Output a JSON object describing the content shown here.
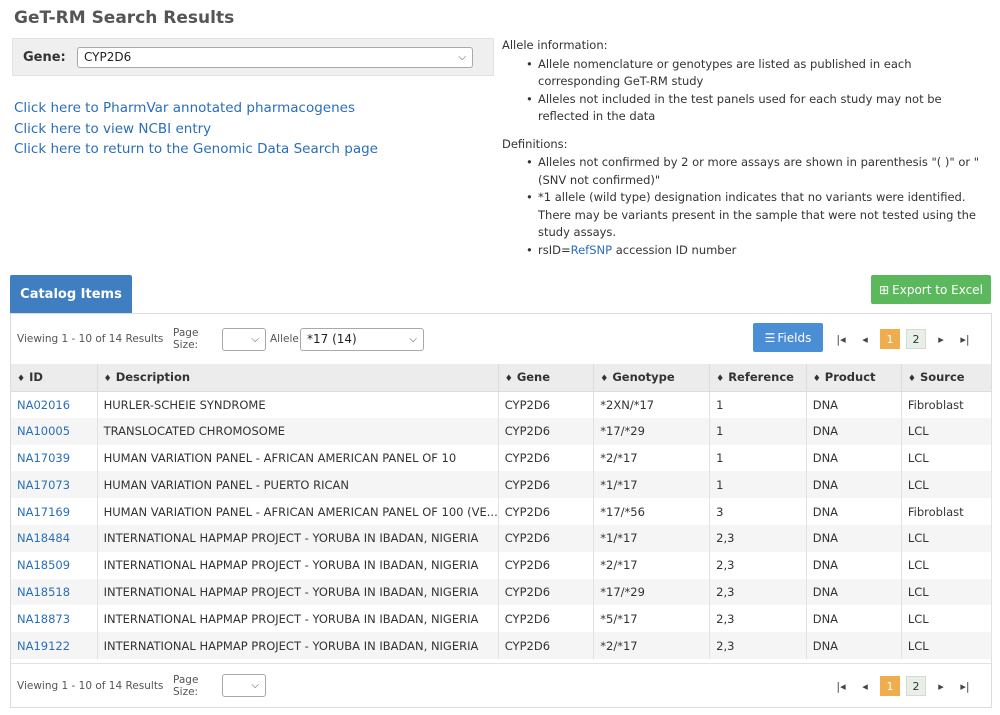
{
  "title": "GeT-RM Search Results",
  "gene": {
    "label": "Gene:",
    "value": "CYP2D6"
  },
  "links": [
    "Click here to PharmVar annotated pharmacogenes",
    "Click here to view NCBI entry",
    "Click here to return to the Genomic Data Search page"
  ],
  "allele_info": {
    "heading": "Allele information:",
    "items": [
      "Allele nomenclature or genotypes are listed as published in each corresponding GeT-RM study",
      "Alleles not included in the test panels used for each study may not be reflected in the data"
    ]
  },
  "definitions": {
    "heading": "Definitions:",
    "items": [
      "Alleles not confirmed by 2 or more assays are shown in parenthesis \"( )\" or \"(SNV not confirmed)\"",
      "*1 allele (wild type) designation indicates that no variants were identified. There may be variants present in the sample that were not tested using the study assays."
    ],
    "rsid_prefix": "rsID=",
    "rsid_link": "RefSNP",
    "rsid_suffix": " accession ID number"
  },
  "catalog_tab": "Catalog Items",
  "export_label": "Export to Excel",
  "toolbar": {
    "viewing": "Viewing 1 - 10 of 14 Results",
    "page_size_label": "Page Size:",
    "allele_label": "Allele:",
    "allele_value": "*17 (14)",
    "fields_label": "Fields"
  },
  "pager": {
    "first": "|◂",
    "prev": "◂",
    "next": "▸",
    "last": "▸|",
    "pages": [
      "1",
      "2"
    ]
  },
  "columns": [
    "ID",
    "Description",
    "Gene",
    "Genotype",
    "Reference",
    "Product",
    "Source"
  ],
  "rows": [
    [
      "NA02016",
      "HURLER-SCHEIE SYNDROME",
      "CYP2D6",
      "*2XN/*17",
      "1",
      "DNA",
      "Fibroblast"
    ],
    [
      "NA10005",
      "TRANSLOCATED CHROMOSOME",
      "CYP2D6",
      "*17/*29",
      "1",
      "DNA",
      "LCL"
    ],
    [
      "NA17039",
      "HUMAN VARIATION PANEL - AFRICAN AMERICAN PANEL OF 10",
      "CYP2D6",
      "*2/*17",
      "1",
      "DNA",
      "LCL"
    ],
    [
      "NA17073",
      "HUMAN VARIATION PANEL - PUERTO RICAN",
      "CYP2D6",
      "*1/*17",
      "1",
      "DNA",
      "LCL"
    ],
    [
      "NA17169",
      "HUMAN VARIATION PANEL - AFRICAN AMERICAN PANEL OF 100 (VE...",
      "CYP2D6",
      "*17/*56",
      "3",
      "DNA",
      "Fibroblast"
    ],
    [
      "NA18484",
      "INTERNATIONAL HAPMAP PROJECT - YORUBA IN IBADAN, NIGERIA",
      "CYP2D6",
      "*1/*17",
      "2,3",
      "DNA",
      "LCL"
    ],
    [
      "NA18509",
      "INTERNATIONAL HAPMAP PROJECT - YORUBA IN IBADAN, NIGERIA",
      "CYP2D6",
      "*2/*17",
      "2,3",
      "DNA",
      "LCL"
    ],
    [
      "NA18518",
      "INTERNATIONAL HAPMAP PROJECT - YORUBA IN IBADAN, NIGERIA",
      "CYP2D6",
      "*17/*29",
      "2,3",
      "DNA",
      "LCL"
    ],
    [
      "NA18873",
      "INTERNATIONAL HAPMAP PROJECT - YORUBA IN IBADAN, NIGERIA",
      "CYP2D6",
      "*5/*17",
      "2,3",
      "DNA",
      "LCL"
    ],
    [
      "NA19122",
      "INTERNATIONAL HAPMAP PROJECT - YORUBA IN IBADAN, NIGERIA",
      "CYP2D6",
      "*2/*17",
      "2,3",
      "DNA",
      "LCL"
    ]
  ],
  "colors": {
    "accent": "#3f7fc1",
    "export": "#5cb85c",
    "active_page": "#f0ad4e",
    "link": "#2a6ebb"
  },
  "icons": [
    "chevron-down-icon",
    "grid-icon",
    "list-icon",
    "sort-icon"
  ]
}
